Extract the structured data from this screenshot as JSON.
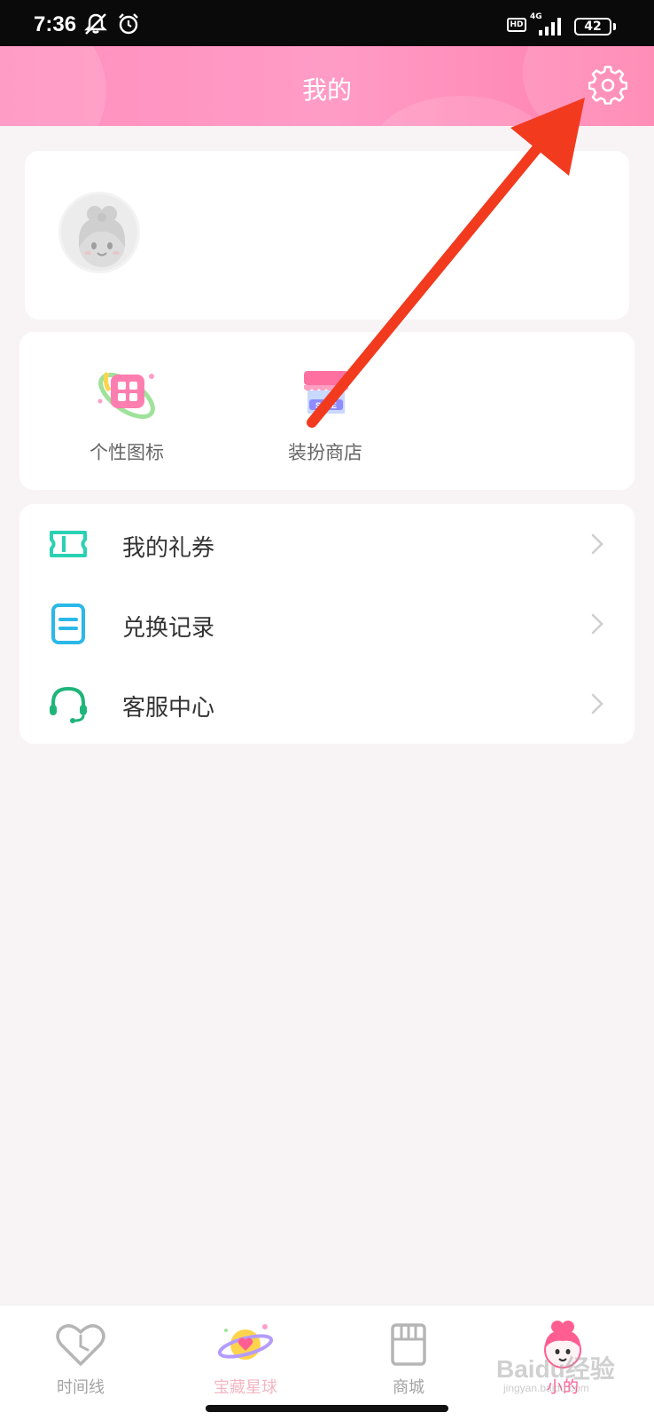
{
  "status_bar": {
    "time": "7:36",
    "hd": "HD",
    "network": "4G",
    "battery": "42"
  },
  "header": {
    "title": "我的",
    "settings_icon": "gear-icon"
  },
  "features": [
    {
      "label": "个性图标",
      "icon": "custom-icon-grid-icon"
    },
    {
      "label": "装扮商店",
      "icon": "dress-up-store-icon"
    }
  ],
  "menu": [
    {
      "label": "我的礼券",
      "icon": "ticket-icon"
    },
    {
      "label": "兑换记录",
      "icon": "record-icon"
    },
    {
      "label": "客服中心",
      "icon": "headset-icon"
    }
  ],
  "bottom_nav": [
    {
      "label": "时间线",
      "icon": "timeline-heart-icon"
    },
    {
      "label": "宝藏星球",
      "icon": "planet-icon"
    },
    {
      "label": "商城",
      "icon": "shop-icon"
    },
    {
      "label": "小的",
      "icon": "profile-girl-icon",
      "active": true
    }
  ],
  "watermark": {
    "text": "Baidu经验",
    "sub": "jingyan.baidu.com"
  },
  "colors": {
    "header_pink": "#ff8fbe",
    "accent_pink": "#ff5e93",
    "annotation_red": "#f23a1f",
    "teal": "#2ad1b3",
    "blue": "#2bb8e8",
    "green": "#1eb57a"
  }
}
